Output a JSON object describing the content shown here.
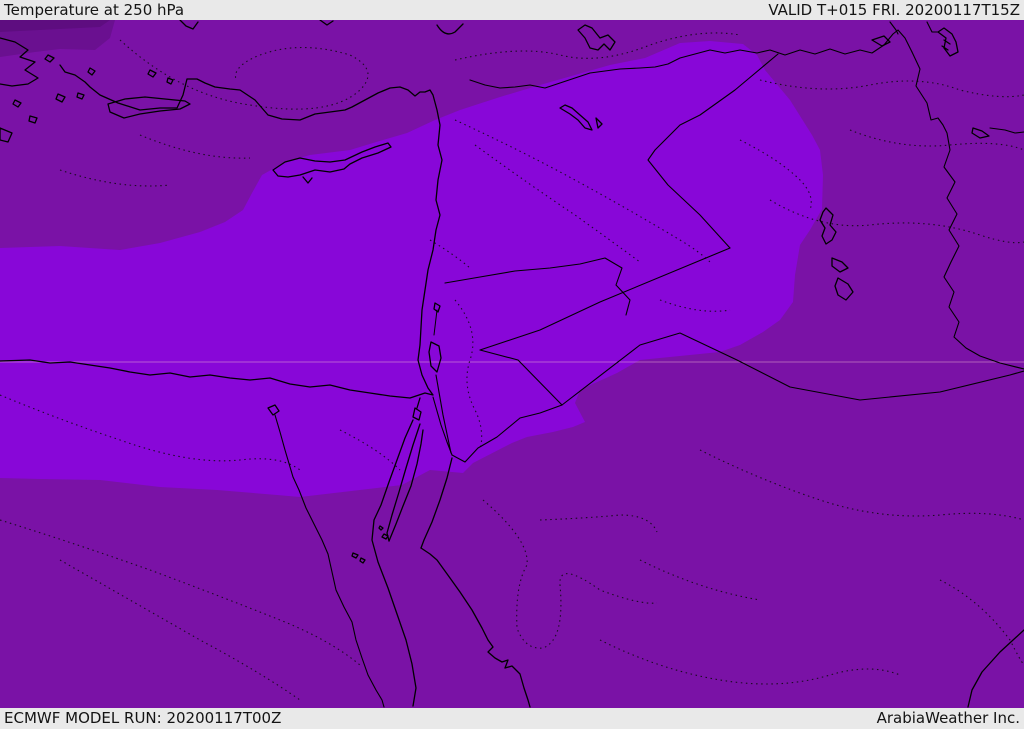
{
  "header": {
    "title": "Temperature at 250 hPa",
    "valid_time": "VALID T+015 FRI. 20200117T15Z"
  },
  "footer": {
    "model_run": "ECMWF MODEL RUN: 20200117T00Z",
    "brand": "ArabiaWeather Inc."
  },
  "map": {
    "description": "ECMWF 250 hPa temperature shading over the Middle East / eastern Mediterranean",
    "colors": {
      "band_warm": "#8807d8",
      "band_mid": "#7a12a6",
      "band_cool": "#6a1090",
      "band_coolest": "#5e0d80",
      "coastline": "#000000",
      "contour_dotted": "#0a0a0a",
      "gridline": "#f2bcd4",
      "bar_background": "#e9e9e9",
      "bar_text": "#141414"
    }
  }
}
